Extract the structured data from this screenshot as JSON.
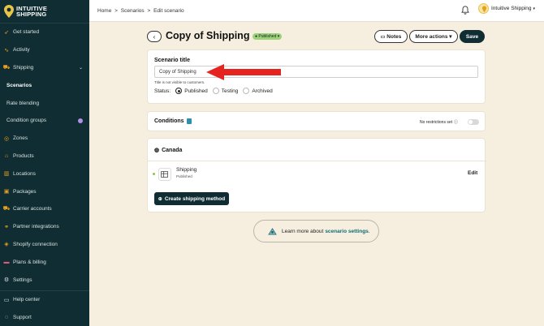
{
  "brand": {
    "line1": "INTUITIVE",
    "line2": "SHIPPING"
  },
  "colors": {
    "sidebar": "#0f2d32",
    "accent": "#e9a020",
    "published_badge": "#9ed277",
    "background": "#f6efe0"
  },
  "sidebar": {
    "items": [
      {
        "label": "Get started",
        "icon": "rocket-icon"
      },
      {
        "label": "Activity",
        "icon": "activity-icon"
      },
      {
        "label": "Shipping",
        "icon": "truck-icon"
      },
      {
        "label": "Scenarios",
        "icon": ""
      },
      {
        "label": "Rate blending",
        "icon": ""
      },
      {
        "label": "Condition groups",
        "icon": ""
      },
      {
        "label": "Zones",
        "icon": "zones-icon"
      },
      {
        "label": "Products",
        "icon": "tag-icon"
      },
      {
        "label": "Locations",
        "icon": "building-icon"
      },
      {
        "label": "Packages",
        "icon": "package-icon"
      },
      {
        "label": "Carrier accounts",
        "icon": "carrier-icon"
      },
      {
        "label": "Partner integrations",
        "icon": "handshake-icon"
      },
      {
        "label": "Shopify connection",
        "icon": "shopify-icon"
      },
      {
        "label": "Plans & billing",
        "icon": "card-icon"
      },
      {
        "label": "Settings",
        "icon": "gear-icon"
      }
    ],
    "bottom": [
      {
        "label": "Help center",
        "icon": "help-icon"
      },
      {
        "label": "Support",
        "icon": "support-icon"
      }
    ]
  },
  "breadcrumb": {
    "home": "Home",
    "sep": ">",
    "scenarios": "Scenarios",
    "current": "Edit scenario"
  },
  "user": {
    "name": "Intuitive Shipping",
    "caret": "▾"
  },
  "header": {
    "back": "‹",
    "title": "Copy of Shipping",
    "status_badge": "● Published ▾",
    "notes": "Notes",
    "more_actions": "More actions ▾",
    "save": "Save"
  },
  "scenario": {
    "title_label": "Scenario title",
    "title_value": "Copy of Shipping",
    "hint": "Title is not visible to customers.",
    "status_label": "Status:",
    "status_options": [
      "Published",
      "Testing",
      "Archived"
    ],
    "status_selected": "Published"
  },
  "conditions": {
    "title": "Conditions",
    "restriction_text": "No restrictions set"
  },
  "region": {
    "name": "Canada",
    "method_name": "Shipping",
    "method_status": "Published",
    "edit": "Edit",
    "create_button": "Create shipping method"
  },
  "learn": {
    "prefix": "Learn more about",
    "link": "scenario settings",
    "suffix": "."
  }
}
